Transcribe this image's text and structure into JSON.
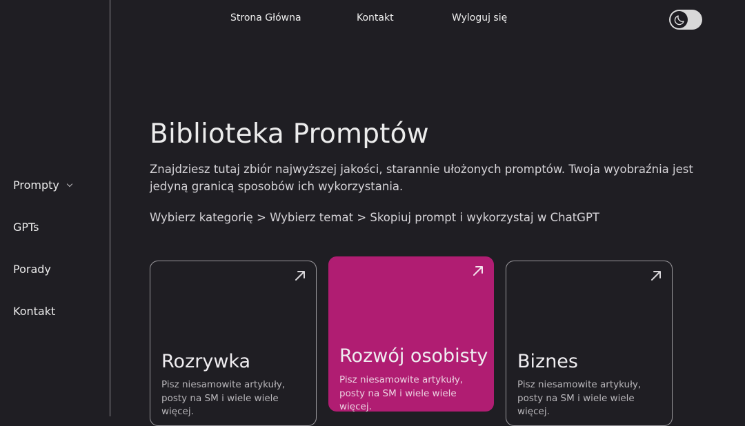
{
  "sidebar": {
    "items": [
      {
        "label": "Prompty",
        "has_dropdown": true
      },
      {
        "label": "GPTs"
      },
      {
        "label": "Porady"
      },
      {
        "label": "Kontakt"
      }
    ]
  },
  "topnav": {
    "home": "Strona Główna",
    "contact": "Kontakt",
    "logout": "Wyloguj się"
  },
  "theme_toggle": {
    "icon": "moon-icon"
  },
  "hero": {
    "title_plain": "Biblioteka ",
    "title_accent": "Promptów",
    "accent_color": "#b31c73",
    "description": "Znajdziesz tutaj zbiór najwyższej jakości, starannie ułożonych promptów. Twoja wyobraźnia jest jedyną granicą sposobów ich wykorzystania.",
    "steps": "Wybierz kategorię > Wybierz temat > Skopiuj prompt i wykorzystaj w ChatGPT"
  },
  "cards": [
    {
      "title": "Rozrywka",
      "description": "Pisz niesamowite artykuły, posty na SM i wiele wiele więcej.",
      "icon": "arrow-up-right-icon"
    },
    {
      "title": "Rozwój osobisty",
      "description": "Pisz niesamowite artykuły, posty na SM i wiele wiele więcej.",
      "icon": "arrow-up-right-icon",
      "highlight_color": "#b01d72"
    },
    {
      "title": "Biznes",
      "description": "Pisz niesamowite artykuły, posty na SM i wiele wiele więcej.",
      "icon": "arrow-up-right-icon"
    }
  ]
}
